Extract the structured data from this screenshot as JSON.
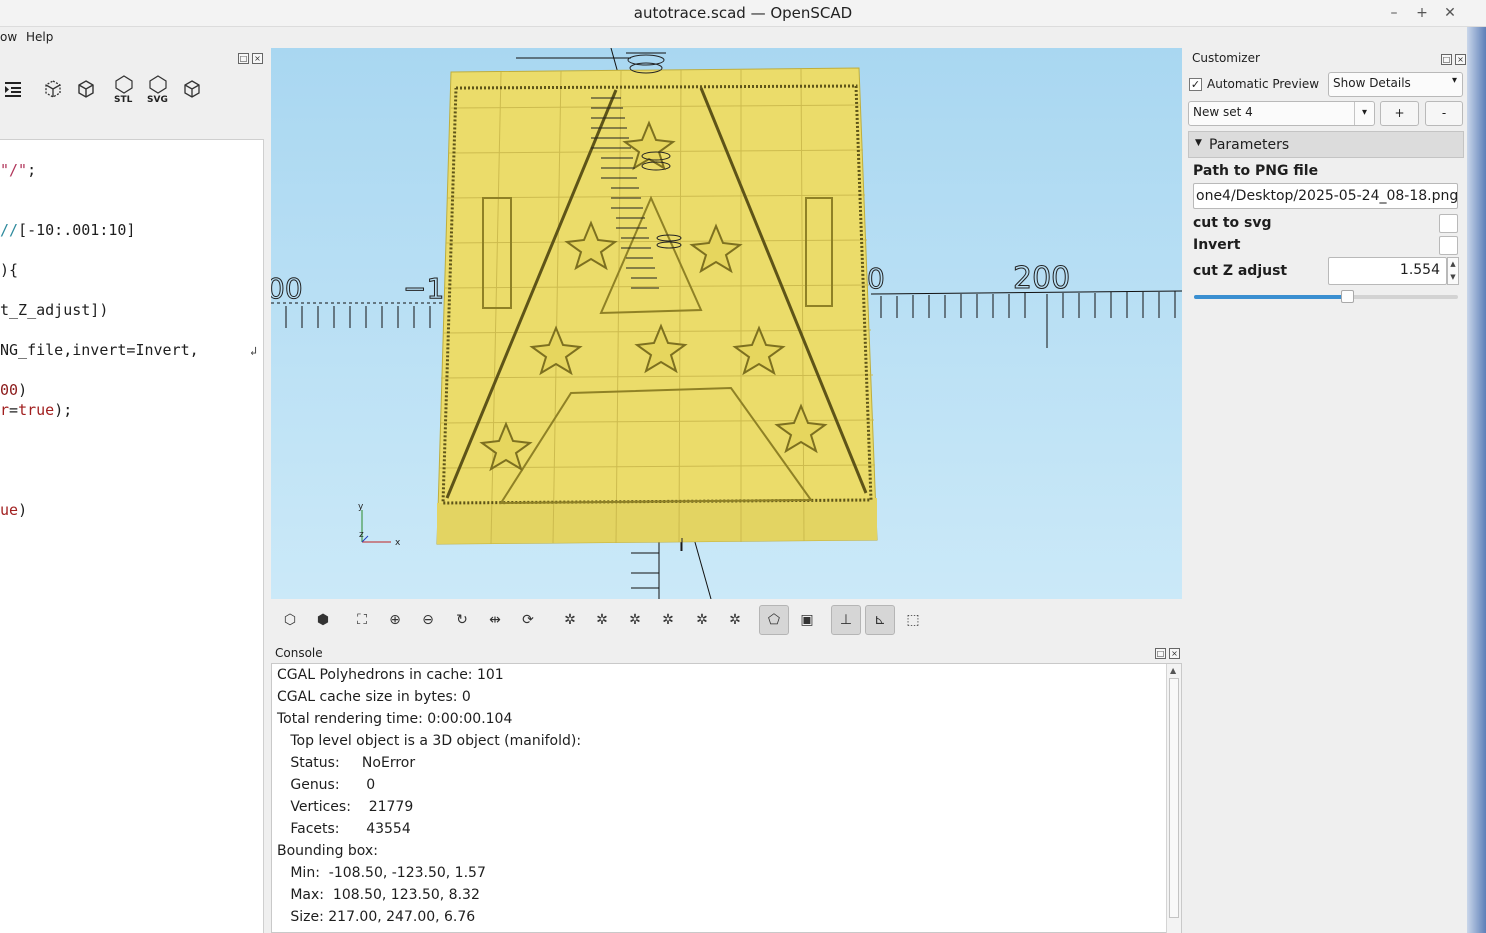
{
  "window": {
    "title": "autotrace.scad — OpenSCAD"
  },
  "menu": {
    "items": [
      "ow",
      "Help"
    ]
  },
  "editor": {
    "toolbar_icons": [
      "indent-icon",
      "preview-icon",
      "render-icon",
      "export-stl-icon",
      "export-svg-icon",
      "export-3d-icon"
    ],
    "export_stl_label": "STL",
    "export_svg_label": "SVG",
    "code_lines": [
      {
        "parts": [
          [
            "str",
            "\"/\""
          ],
          [
            "",
            ";"
          ]
        ]
      },
      {
        "parts": [
          [
            "cmt",
            "//"
          ],
          [
            "",
            "[-10:.001:10]"
          ]
        ]
      },
      {
        "parts": [
          [
            "",
            "){"
          ]
        ]
      },
      {
        "parts": [
          [
            "",
            "t_Z_adjust])"
          ]
        ]
      },
      {
        "parts": [
          [
            "",
            "NG_file,invert=Invert,"
          ]
        ]
      },
      {
        "parts": [
          [
            "num",
            "00"
          ],
          [
            "",
            ")"
          ]
        ]
      },
      {
        "parts": [
          [
            "kw",
            "r"
          ],
          [
            "",
            "="
          ],
          [
            "kw",
            "true"
          ],
          [
            "",
            ");"
          ]
        ]
      },
      {
        "parts": [
          [
            "kw",
            "ue"
          ],
          [
            "",
            ")"
          ]
        ]
      }
    ]
  },
  "viewport": {
    "axis_labels": [
      "00",
      "−1",
      "0",
      "200"
    ],
    "model_color": "#ebdc6a",
    "background_top": "#a9d7f1",
    "background_bottom": "#cbe9f8"
  },
  "view_toolbar": {
    "tools": [
      "preview-icon",
      "render-icon",
      "view-all-icon",
      "zoom-in-icon",
      "zoom-out-icon",
      "reset-view-icon",
      "view-perspective-icon",
      "view-ortho-icon",
      "view-right-icon",
      "view-left-icon",
      "view-front-icon",
      "view-back-icon",
      "view-top-icon",
      "view-bottom-icon",
      "perspective-icon",
      "orthogonal-icon",
      "show-axes-icon",
      "show-scale-icon",
      "show-edges-icon"
    ]
  },
  "console": {
    "title": "Console",
    "lines": [
      "CGAL Polyhedrons in cache: 101",
      "CGAL cache size in bytes: 0",
      "Total rendering time: 0:00:00.104",
      "   Top level object is a 3D object (manifold):",
      "   Status:     NoError",
      "   Genus:      0",
      "   Vertices:    21779",
      "   Facets:      43554",
      "Bounding box:",
      "   Min:  -108.50, -123.50, 1.57",
      "   Max:  108.50, 123.50, 8.32",
      "   Size: 217.00, 247.00, 6.76"
    ]
  },
  "customizer": {
    "title": "Customizer",
    "auto_preview_label": "Automatic Preview",
    "auto_preview_checked": true,
    "details_value": "Show Details",
    "preset_value": "New set 4",
    "add_label": "+",
    "remove_label": "-",
    "section_label": "Parameters",
    "params": {
      "png_label": "Path to PNG file",
      "png_value": "one4/Desktop/2025-05-24_08-18.png",
      "svg_label": "cut to svg",
      "invert_label": "Invert",
      "z_label": "cut Z adjust",
      "z_value": "1.554",
      "z_slider_fraction": 0.58
    }
  }
}
